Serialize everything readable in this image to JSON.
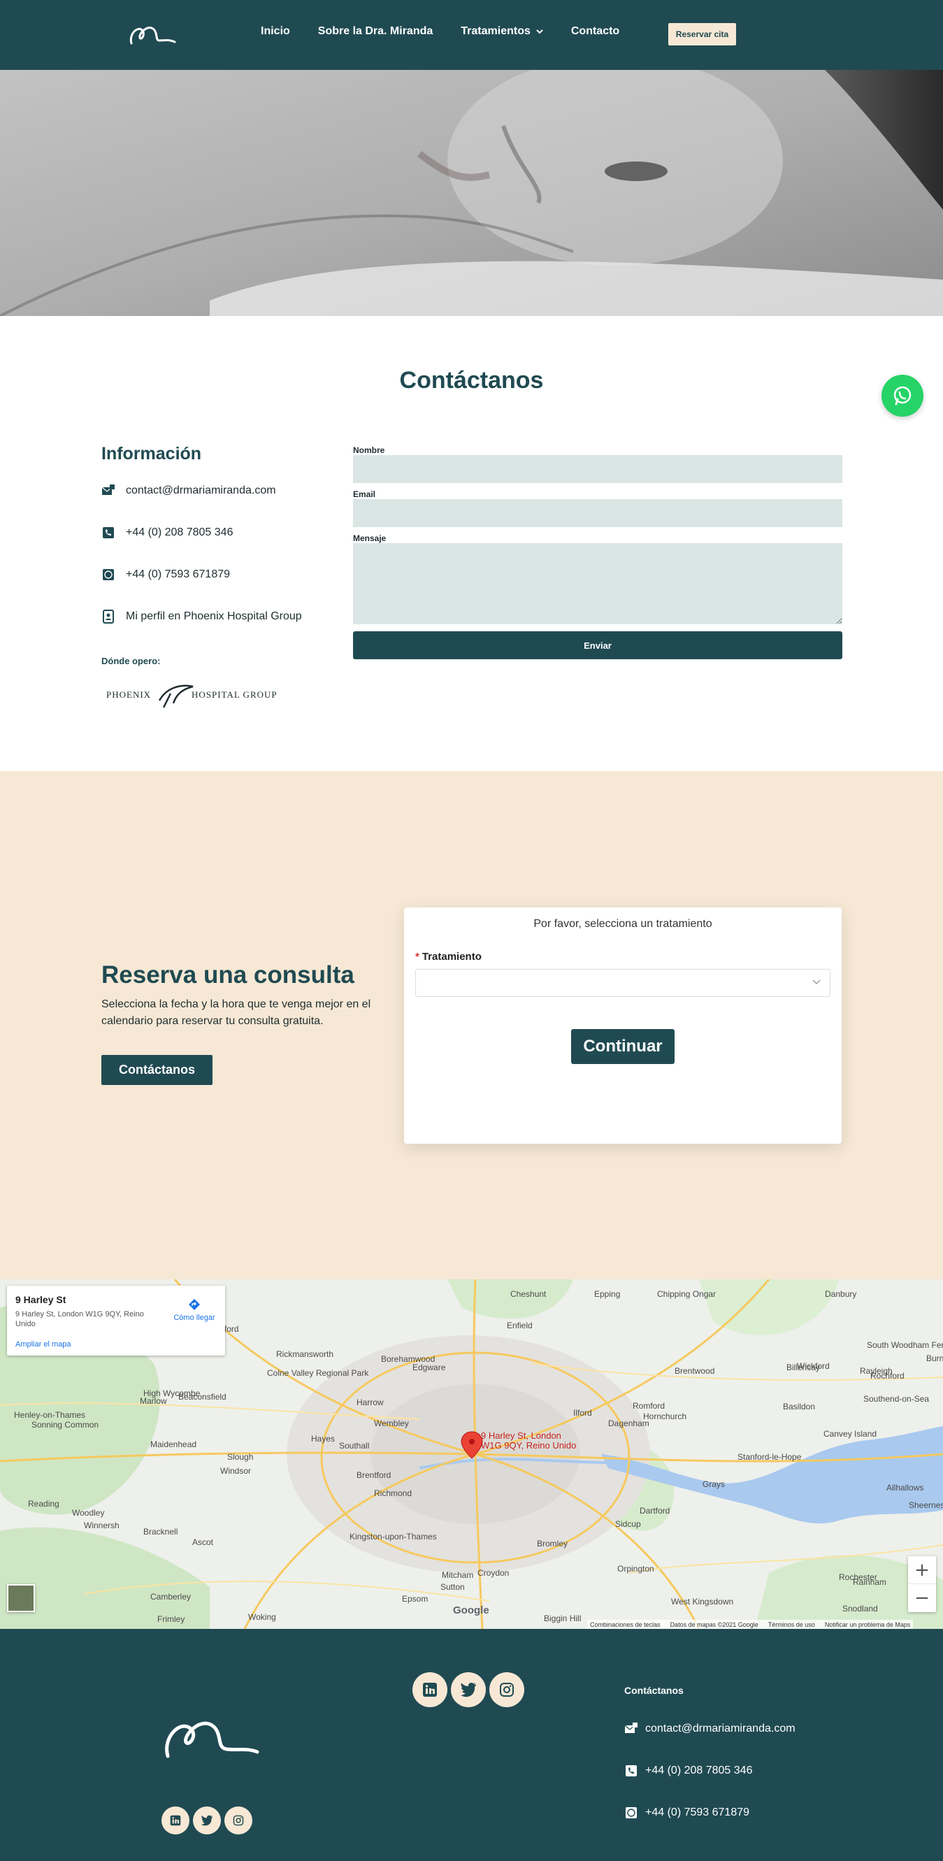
{
  "nav": {
    "items": [
      {
        "label": "Inicio"
      },
      {
        "label": "Sobre la Dra. Miranda"
      },
      {
        "label": "Tratamientos"
      },
      {
        "label": "Contacto"
      }
    ],
    "reserve_label": "Reservar cita",
    "logo_icon": "signature-logo-icon"
  },
  "contact": {
    "title": "Contáctanos",
    "info_title": "Información",
    "email": "contact@drmariamiranda.com",
    "phone": "+44 (0) 208 7805 346",
    "whatsapp": "+44 (0) 7593 671879",
    "profile": "Mi perfil en Phoenix Hospital Group",
    "where_label": "Dónde opero:",
    "partner_logo_left": "PHOENIX",
    "partner_logo_right": "HOSPITAL GROUP",
    "form": {
      "name_label": "Nombre",
      "email_label": "Email",
      "message_label": "Mensaje",
      "submit_label": "Enviar"
    }
  },
  "booking": {
    "title": "Reserva una consulta",
    "description": "Selecciona la fecha y la hora que te venga mejor en el calendario para reservar tu consulta gratuita.",
    "button_label": "Contáctanos",
    "widget": {
      "prompt": "Por favor, selecciona un tratamiento",
      "required_mark": "*",
      "treatment_label": "Tratamiento",
      "selected_value": "",
      "continue_label": "Continuar"
    }
  },
  "map": {
    "place_name": "9 Harley St",
    "place_address": "9 Harley St, London W1G 9QY, Reino Unido",
    "directions_label": "Cómo llegar",
    "enlarge_label": "Ampliar el mapa",
    "pin_label_line1": "9 Harley St, London",
    "pin_label_line2": "W1G 9QY, Reino Unido",
    "zoom_in": "+",
    "zoom_out": "−",
    "google": "Google",
    "attribution": [
      "Combinaciones de teclas",
      "Datos de mapas ©2021 Google",
      "Términos de uso",
      "Notificar un problema de Maps"
    ],
    "places": [
      "Watford",
      "Enfield",
      "Cheshunt",
      "Epping",
      "Chipping Ongar",
      "Danbury",
      "Brentwood",
      "Billericay",
      "Wickford",
      "Rayleigh",
      "Rochford",
      "Southend-on-Sea",
      "Basildon",
      "Canvey Island",
      "Romford",
      "Hornchurch",
      "Dagenham",
      "Ilford",
      "Edgware",
      "Harrow",
      "Wembley",
      "Hayes",
      "Southall",
      "Slough",
      "Maidenhead",
      "Windsor",
      "Reading",
      "Bracknell",
      "Ascot",
      "Woking",
      "Camberley",
      "Epsom",
      "Sutton",
      "Croydon",
      "Mitcham",
      "Bromley",
      "Sidcup",
      "Dartford",
      "Grays",
      "Orpington",
      "Kingston-upon-Thames",
      "Richmond",
      "Brentford",
      "High Wycombe",
      "Marlow",
      "Beaconsfield",
      "Rickmansworth",
      "Borehamwood",
      "Colne Valley Regional Park",
      "Henley-on-Thames",
      "Sonning Common",
      "Woodley",
      "Winnersh",
      "Stanford-le-Hope",
      "Rochester",
      "Rainham",
      "West Kingsdown",
      "Snodland",
      "Biggin Hill",
      "Frimley",
      "Allhallows",
      "Sheerness",
      "South Woodham Ferrers",
      "Burnham"
    ]
  },
  "footer": {
    "contact_title": "Contáctanos",
    "email": "contact@drmariamiranda.com",
    "phone": "+44 (0) 208 7805 346",
    "whatsapp": "+44 (0) 7593 671879",
    "social": [
      "linkedin-icon",
      "twitter-icon",
      "instagram-icon"
    ]
  },
  "colors": {
    "brand_dark": "#204a52",
    "cream": "#f7e8d5",
    "field_bg": "#d9e6e4",
    "whatsapp": "#25d366"
  }
}
